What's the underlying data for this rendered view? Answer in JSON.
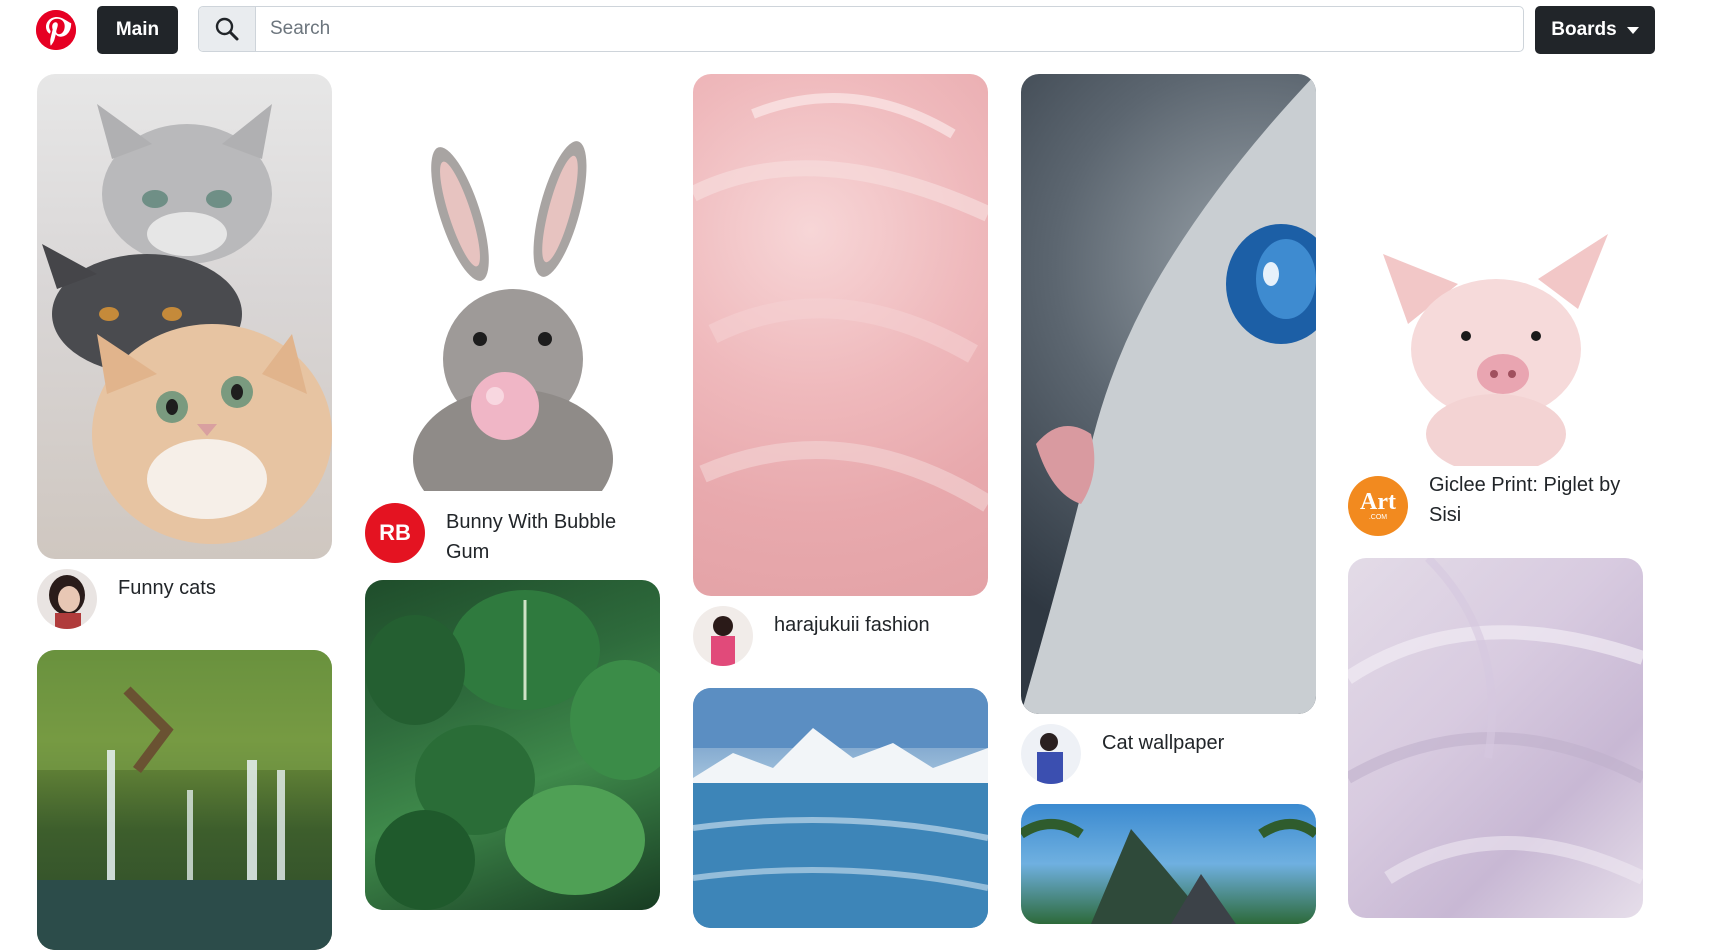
{
  "app": {
    "brand_icon": "pinterest-logo-icon",
    "brand_color": "#e60023"
  },
  "header": {
    "main_label": "Main",
    "search_placeholder": "Search",
    "search_value": "",
    "boards_label": "Boards"
  },
  "pins": [
    {
      "title": "Funny cats",
      "image": "cats-photo",
      "avatar": "user-avatar"
    },
    {
      "title": "Bunny With Bubble Gum",
      "image": "bunny-photo",
      "avatar": "redbubble-avatar",
      "avatar_text": "RB"
    },
    {
      "title": "harajukuii fashion",
      "image": "pink-feathers-photo",
      "avatar": "user-avatar"
    },
    {
      "title": "Cat wallpaper",
      "image": "cat-eye-photo",
      "avatar": "user-avatar"
    },
    {
      "title": "Giclee Print: Piglet by Sisi",
      "image": "piglet-photo",
      "avatar": "art-com-avatar",
      "avatar_text": "Art",
      "avatar_subtext": ".COM"
    },
    {
      "title": "",
      "image": "forest-waterfall-photo"
    },
    {
      "title": "",
      "image": "green-leaves-photo"
    },
    {
      "title": "",
      "image": "frozen-lake-mountains-photo"
    },
    {
      "title": "",
      "image": "tropical-mountain-photo"
    },
    {
      "title": "",
      "image": "lilac-feathers-photo"
    }
  ]
}
